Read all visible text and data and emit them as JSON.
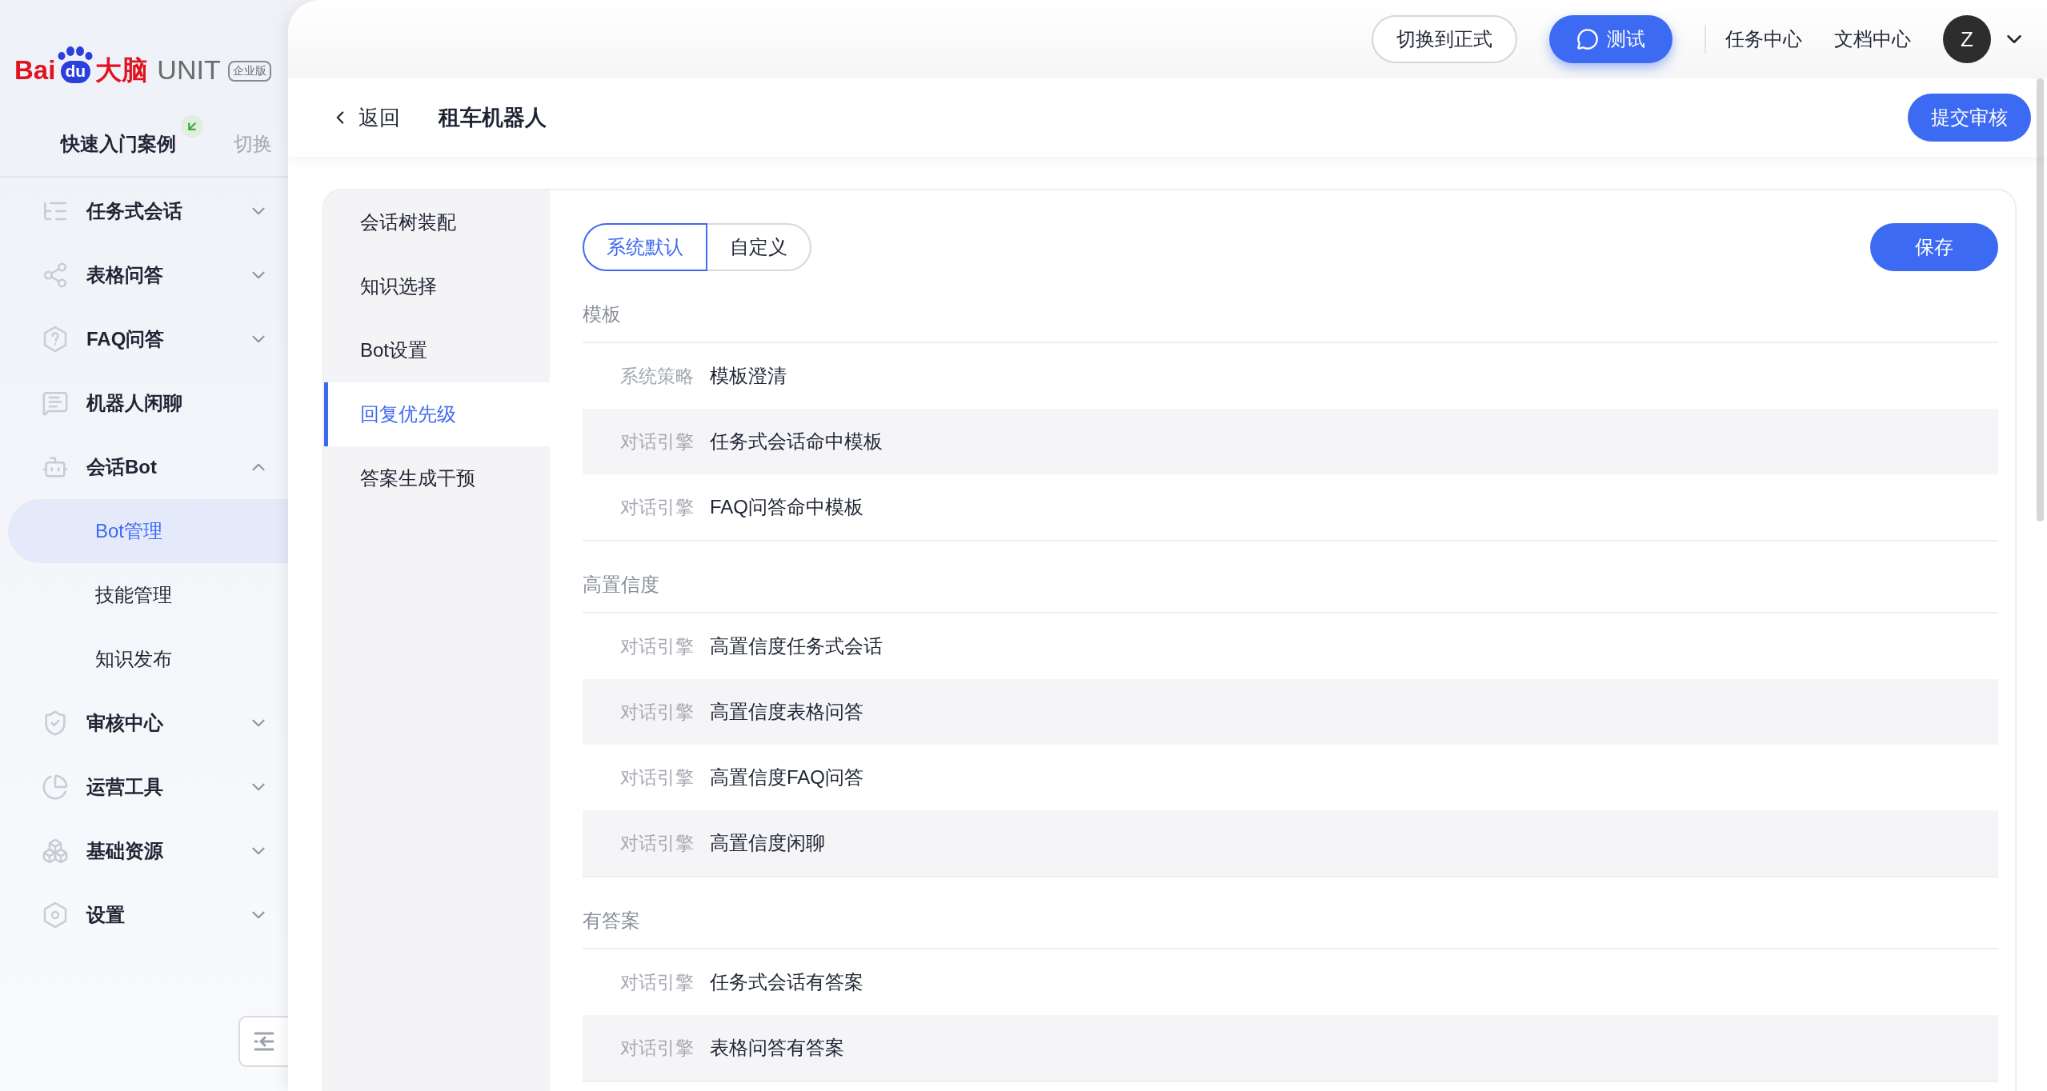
{
  "logo": {
    "brand_left": "Bai",
    "brand_paw": "du",
    "brand_cn": "大脑",
    "product": "UNIT",
    "edition": "企业版"
  },
  "workspace": {
    "name": "快速入门案例",
    "action": "切换"
  },
  "sidebar": {
    "items": [
      {
        "label": "任务式会话",
        "expanded": false
      },
      {
        "label": "表格问答",
        "expanded": false
      },
      {
        "label": "FAQ问答",
        "expanded": false
      },
      {
        "label": "机器人闲聊"
      },
      {
        "label": "会话Bot",
        "expanded": true,
        "children": [
          {
            "label": "Bot管理",
            "selected": true
          },
          {
            "label": "技能管理",
            "selected": false
          },
          {
            "label": "知识发布",
            "selected": false
          }
        ]
      },
      {
        "label": "审核中心",
        "expanded": false
      },
      {
        "label": "运营工具",
        "expanded": false
      },
      {
        "label": "基础资源",
        "expanded": false
      },
      {
        "label": "设置",
        "expanded": false
      }
    ]
  },
  "topbar": {
    "switch_button": "切换到正式",
    "test_button": "测试",
    "links": [
      "任务中心",
      "文档中心"
    ],
    "avatar": "Z"
  },
  "header": {
    "back": "返回",
    "title": "租车机器人",
    "submit": "提交审核"
  },
  "subnav": [
    {
      "label": "会话树装配",
      "selected": false
    },
    {
      "label": "知识选择",
      "selected": false
    },
    {
      "label": "Bot设置",
      "selected": false
    },
    {
      "label": "回复优先级",
      "selected": true
    },
    {
      "label": "答案生成干预",
      "selected": false
    }
  ],
  "mode_tabs": [
    {
      "label": "系统默认",
      "selected": true
    },
    {
      "label": "自定义",
      "selected": false
    }
  ],
  "save": "保存",
  "sections": [
    {
      "title": "模板",
      "rows": [
        {
          "label": "系统策略",
          "value": "模板澄清"
        },
        {
          "label": "对话引擎",
          "value": "任务式会话命中模板"
        },
        {
          "label": "对话引擎",
          "value": "FAQ问答命中模板"
        }
      ]
    },
    {
      "title": "高置信度",
      "rows": [
        {
          "label": "对话引擎",
          "value": "高置信度任务式会话"
        },
        {
          "label": "对话引擎",
          "value": "高置信度表格问答"
        },
        {
          "label": "对话引擎",
          "value": "高置信度FAQ问答"
        },
        {
          "label": "对话引擎",
          "value": "高置信度闲聊"
        }
      ]
    },
    {
      "title": "有答案",
      "rows": [
        {
          "label": "对话引擎",
          "value": "任务式会话有答案"
        },
        {
          "label": "对话引擎",
          "value": "表格问答有答案"
        }
      ]
    }
  ]
}
